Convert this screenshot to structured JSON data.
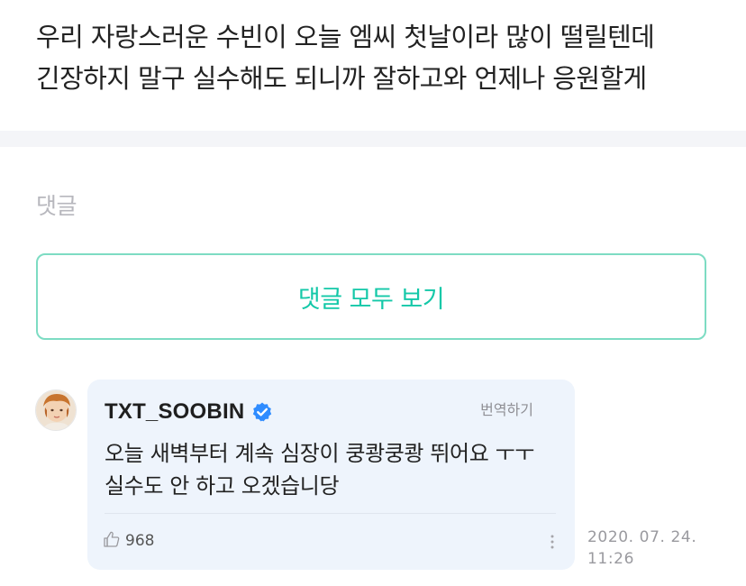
{
  "post": {
    "line1": "우리 자랑스러운 수빈이 오늘 엠씨 첫날이라 많이 떨릴텐데",
    "line2": "긴장하지 말구 실수해도 되니까 잘하고와 언제나 응원할게"
  },
  "comments_section": {
    "label": "댓글",
    "view_all_label": "댓글 모두 보기"
  },
  "comment": {
    "author": "TXT_SOOBIN",
    "verified_icon": "verified-badge-icon",
    "translate_label": "번역하기",
    "body_line1": "오늘 새벽부터 계속 심장이 쿵쾅쿵쾅 뛰어요 ㅜㅜ",
    "body_line2": "실수도 안 하고 오겠습니당",
    "like_icon": "thumbs-up-icon",
    "like_count": "968",
    "more_icon": "more-vertical-icon",
    "date": "2020. 07. 24.",
    "time": "11:26"
  },
  "colors": {
    "accent": "#14c8a8",
    "accent_border": "#7ddcc3",
    "comment_bg": "#eef4fc",
    "verified": "#2f8cff"
  }
}
